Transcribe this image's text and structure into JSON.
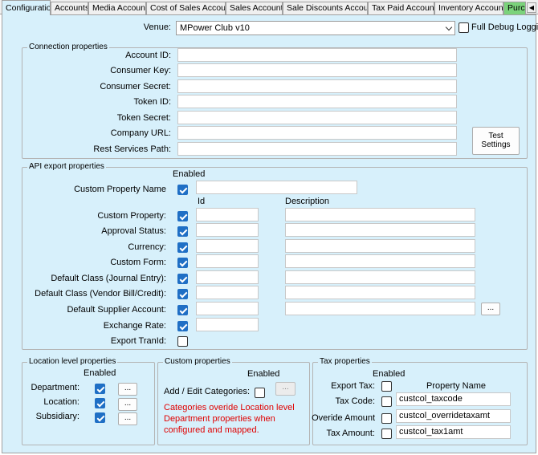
{
  "tabs": [
    {
      "label": "Configuration",
      "active": true
    },
    {
      "label": "Accounts"
    },
    {
      "label": "Media Accounts"
    },
    {
      "label": "Cost of Sales Account"
    },
    {
      "label": "Sales Accounts"
    },
    {
      "label": "Sale Discounts Account"
    },
    {
      "label": "Tax Paid Accounts"
    },
    {
      "label": "Inventory Accounts"
    },
    {
      "label": "Purcl"
    }
  ],
  "header": {
    "venue_label": "Venue:",
    "venue_value": "MPower Club v10",
    "debug_label": "Full Debug Logging"
  },
  "connection": {
    "title": "Connection properties",
    "fields": [
      {
        "label": "Account ID:",
        "value": ""
      },
      {
        "label": "Consumer Key:",
        "value": ""
      },
      {
        "label": "Consumer Secret:",
        "value": ""
      },
      {
        "label": "Token ID:",
        "value": ""
      },
      {
        "label": "Token Secret:",
        "value": ""
      },
      {
        "label": "Company URL:",
        "value": ""
      },
      {
        "label": "Rest Services Path:",
        "value": ""
      }
    ],
    "test_button": "Test Settings"
  },
  "api_export": {
    "title": "API export properties",
    "enabled_header": "Enabled",
    "custom_property_name_label": "Custom Property Name",
    "id_header": "Id",
    "description_header": "Description",
    "rows": [
      {
        "label": "Custom Property:"
      },
      {
        "label": "Approval Status:"
      },
      {
        "label": "Currency:"
      },
      {
        "label": "Custom Form:"
      },
      {
        "label": "Default Class (Journal Entry):"
      },
      {
        "label": "Default Class (Vendor Bill/Credit):"
      },
      {
        "label": "Default Supplier Account:"
      },
      {
        "label": "Exchange Rate:"
      },
      {
        "label": "Export TranId:"
      }
    ],
    "ellipsis": "..."
  },
  "location": {
    "title": "Location level properties",
    "enabled_header": "Enabled",
    "rows": [
      {
        "label": "Department:"
      },
      {
        "label": "Location:"
      },
      {
        "label": "Subsidiary:"
      }
    ],
    "ellipsis": "..."
  },
  "custom": {
    "title": "Custom properties",
    "enabled_header": "Enabled",
    "add_edit_label": "Add / Edit Categories:",
    "ellipsis": "...",
    "warning": "Categories overide Location level Department properties when configured and mapped."
  },
  "tax": {
    "title": "Tax properties",
    "enabled_header": "Enabled",
    "property_name_header": "Property Name",
    "export_tax_label": "Export Tax:",
    "rows": [
      {
        "label": "Tax Code:",
        "value": "custcol_taxcode"
      },
      {
        "label": "Overide Amount",
        "value": "custcol_overridetaxamt"
      },
      {
        "label": "Tax Amount:",
        "value": "custcol_tax1amt"
      }
    ]
  },
  "colors": {
    "panel_bg": "#d7f0fb",
    "checkbox_checked": "#1f6fc5",
    "warning_text": "#e00000",
    "tab_highlight": "#7bd37b"
  }
}
